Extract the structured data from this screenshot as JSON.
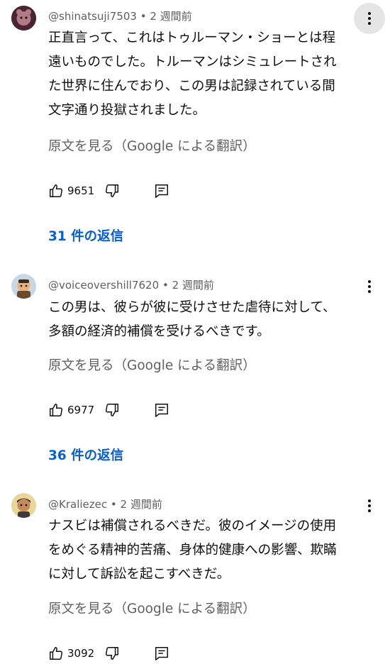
{
  "comments": [
    {
      "author": "@shinatsuji7503",
      "time": "2 週間前",
      "text": "正直言って、これはトゥルーマン・ショーとは程\n遠いものでした。トルーマンはシミュレートされ\nた世界に住んでおり、この男は記録されている間\n文字通り投獄されました。",
      "translate_label": "原文を見る（Google による翻訳）",
      "likes": "9651",
      "replies_label": "31 件の返信"
    },
    {
      "author": "@voiceovershill7620",
      "time": "2 週間前",
      "text": "この男は、彼らが彼に受けさせた虐待に対して、\n多額の経済的補償を受けるべきです。",
      "translate_label": "原文を見る（Google による翻訳）",
      "likes": "6977",
      "replies_label": "36 件の返信"
    },
    {
      "author": "@Kraliezec",
      "time": "2 週間前",
      "text": "ナスビは補償されるべきだ。彼のイメージの使用\nをめぐる精神的苦痛、身体的健康への影響、欺瞞\nに対して訴訟を起こすべきだ。",
      "translate_label": "原文を見る（Google による翻訳）",
      "likes": "3092"
    }
  ],
  "separator": "•",
  "icons": [
    "avatar",
    "more-vert-icon",
    "thumb-up-icon",
    "thumb-down-icon",
    "reply-icon"
  ],
  "colors": {
    "link": "#065fd4",
    "secondary": "#606060",
    "primary": "#0f0f0f"
  }
}
